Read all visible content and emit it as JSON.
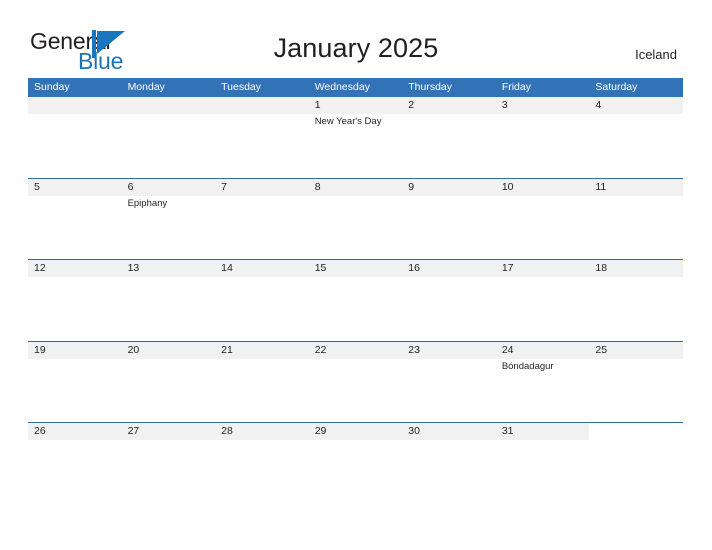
{
  "brand": {
    "name_part1": "General",
    "name_part2": "Blue",
    "mark_icon": "triangle-flag-icon"
  },
  "header": {
    "title": "January 2025",
    "region": "Iceland"
  },
  "colors": {
    "header_blue": "#3173b6",
    "row_divider_blue": "#2e6da4",
    "band_gray": "#f1f1f1",
    "brand_blue": "#1b75bc",
    "text_dark": "#231f20"
  },
  "calendar": {
    "weekdays": [
      "Sunday",
      "Monday",
      "Tuesday",
      "Wednesday",
      "Thursday",
      "Friday",
      "Saturday"
    ],
    "weeks": [
      [
        {
          "day": "",
          "events": []
        },
        {
          "day": "",
          "events": []
        },
        {
          "day": "",
          "events": []
        },
        {
          "day": "1",
          "events": [
            "New Year's Day"
          ]
        },
        {
          "day": "2",
          "events": []
        },
        {
          "day": "3",
          "events": []
        },
        {
          "day": "4",
          "events": []
        }
      ],
      [
        {
          "day": "5",
          "events": []
        },
        {
          "day": "6",
          "events": [
            "Epiphany"
          ]
        },
        {
          "day": "7",
          "events": []
        },
        {
          "day": "8",
          "events": []
        },
        {
          "day": "9",
          "events": []
        },
        {
          "day": "10",
          "events": []
        },
        {
          "day": "11",
          "events": []
        }
      ],
      [
        {
          "day": "12",
          "events": []
        },
        {
          "day": "13",
          "events": []
        },
        {
          "day": "14",
          "events": []
        },
        {
          "day": "15",
          "events": []
        },
        {
          "day": "16",
          "events": []
        },
        {
          "day": "17",
          "events": []
        },
        {
          "day": "18",
          "events": []
        }
      ],
      [
        {
          "day": "19",
          "events": []
        },
        {
          "day": "20",
          "events": []
        },
        {
          "day": "21",
          "events": []
        },
        {
          "day": "22",
          "events": []
        },
        {
          "day": "23",
          "events": []
        },
        {
          "day": "24",
          "events": [
            "Bóndadagur"
          ]
        },
        {
          "day": "25",
          "events": []
        }
      ],
      [
        {
          "day": "26",
          "events": []
        },
        {
          "day": "27",
          "events": []
        },
        {
          "day": "28",
          "events": []
        },
        {
          "day": "29",
          "events": []
        },
        {
          "day": "30",
          "events": []
        },
        {
          "day": "31",
          "events": []
        },
        {
          "day": "",
          "events": []
        }
      ]
    ]
  }
}
